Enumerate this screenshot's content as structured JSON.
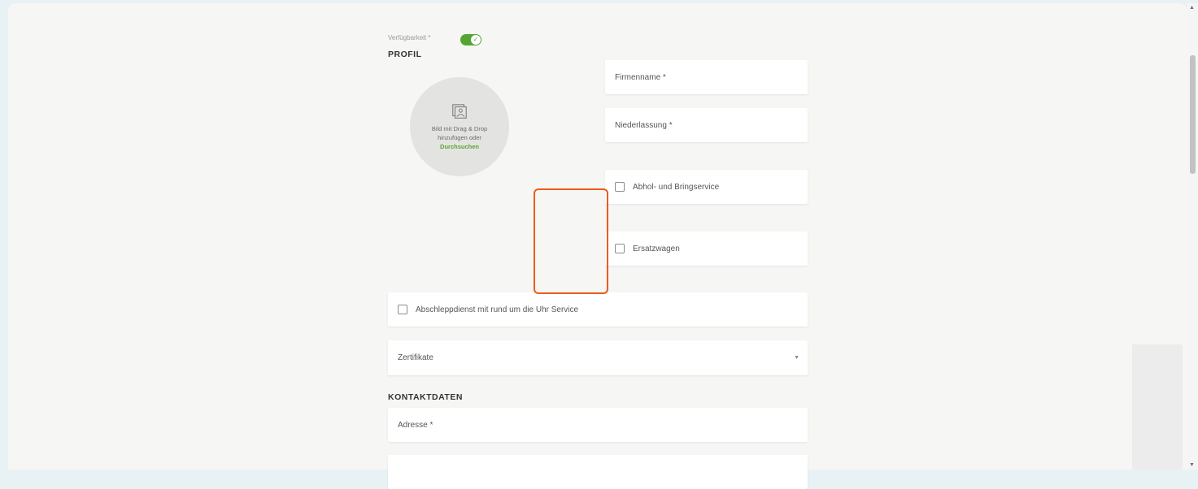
{
  "availability": {
    "label": "Verfügbarkeit *",
    "enabled": true
  },
  "profile": {
    "title": "PROFIL",
    "image_upload": {
      "line1": "Bild mit Drag & Drop",
      "line2": "hinzufügen oder",
      "browse_link": "Durchsuchen",
      "icon": "image-icon"
    },
    "company_name_placeholder": "Firmenname *",
    "branch_placeholder": "Niederlassung *",
    "pickup_service_label": "Abhol- und Bringservice",
    "replacement_car_label": "Ersatzwagen",
    "towing_service_label": "Abschleppdienst mit rund um die Uhr Service",
    "certificates_placeholder": "Zertifikate"
  },
  "contact": {
    "title": "KONTAKTDATEN",
    "address_placeholder": "Adresse *"
  },
  "colors": {
    "accent": "#55a630",
    "highlight": "#f05a1a",
    "background": "#f6f6f4"
  }
}
